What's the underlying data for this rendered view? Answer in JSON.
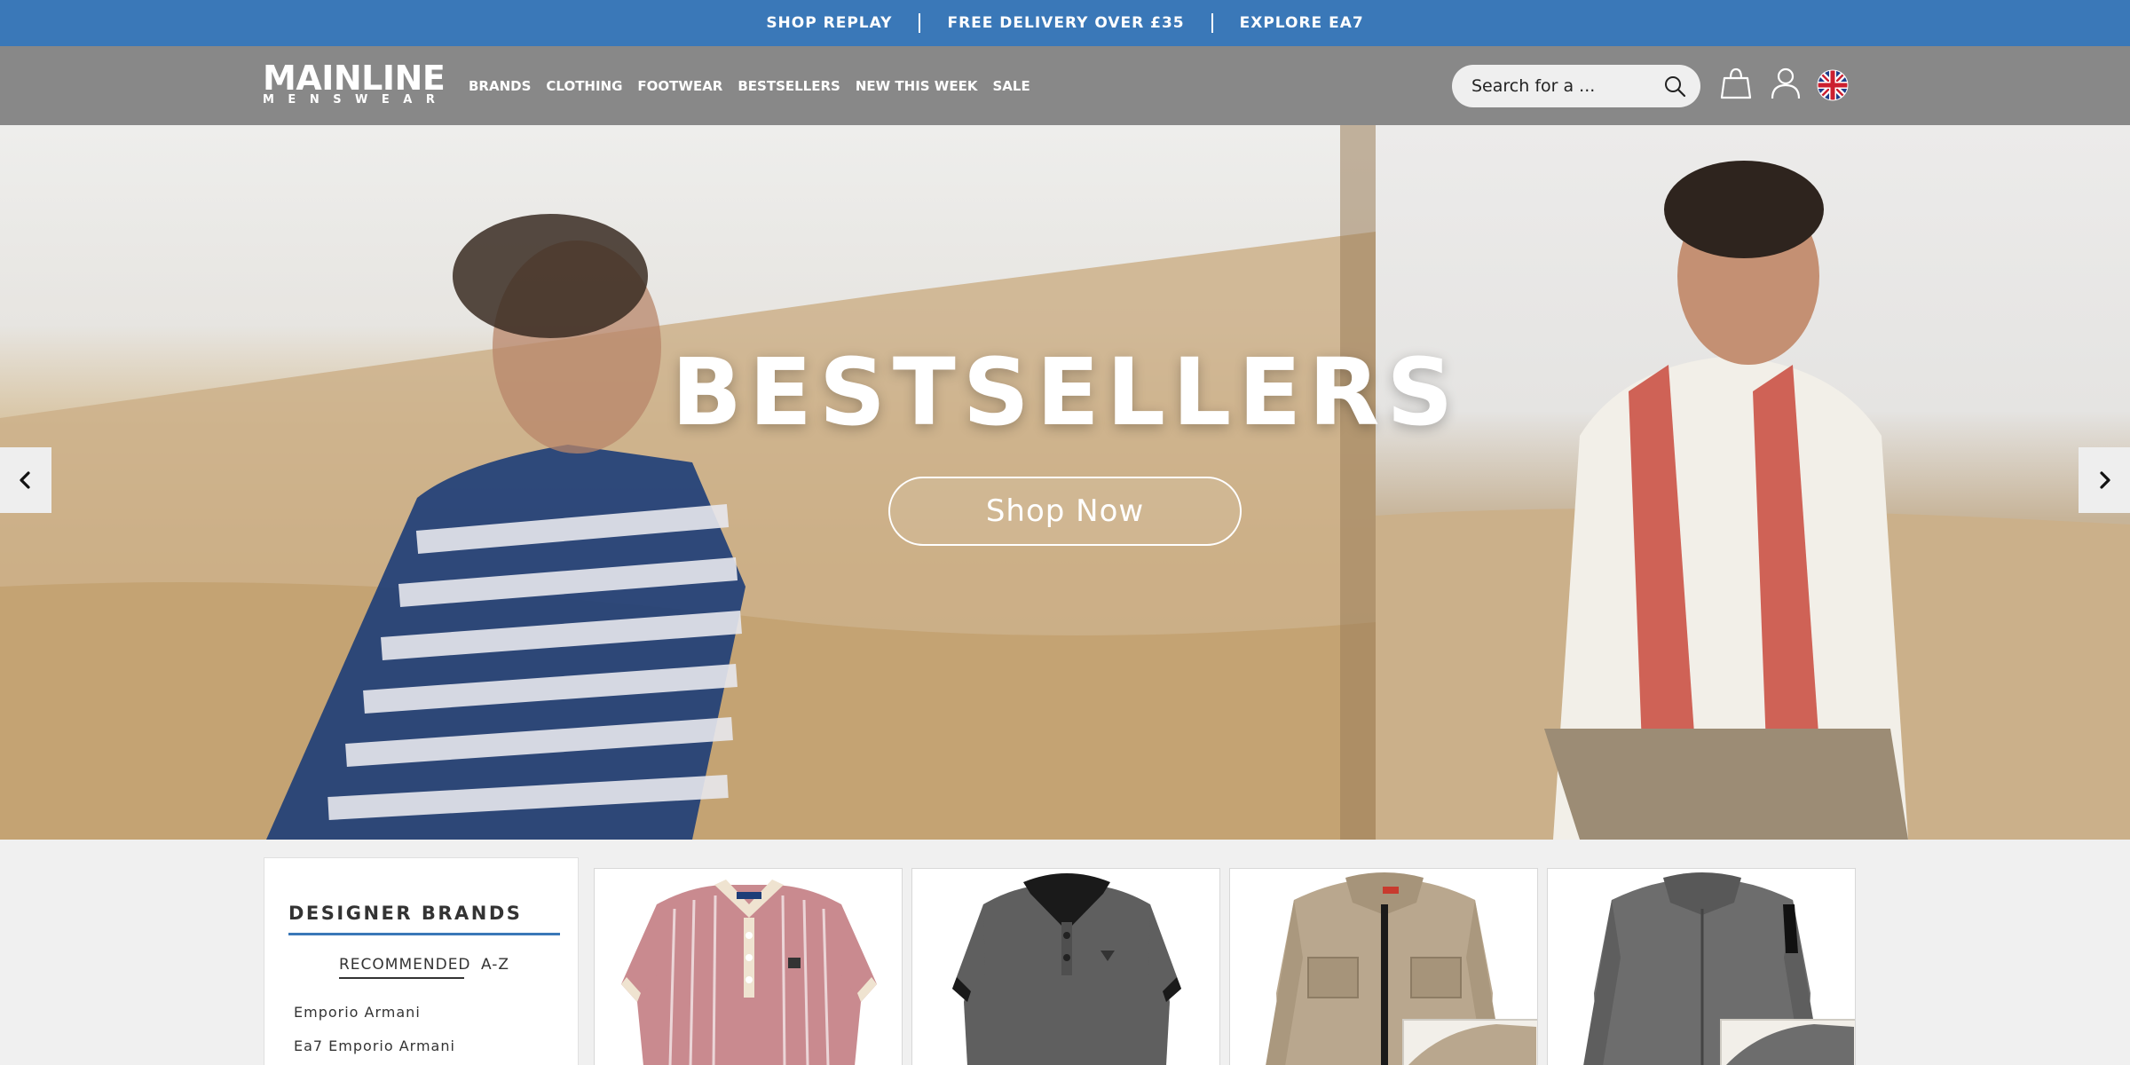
{
  "promo_bar": {
    "items": [
      "SHOP REPLAY",
      "FREE DELIVERY OVER £35",
      "EXPLORE EA7"
    ],
    "color": "#3a78b8"
  },
  "header": {
    "logo_main": "MAINLINE",
    "logo_sub": "MENSWEAR",
    "nav": [
      "BRANDS",
      "CLOTHING",
      "FOOTWEAR",
      "BESTSELLERS",
      "NEW THIS WEEK",
      "SALE"
    ],
    "search_placeholder": "Search for a ...",
    "icons": [
      "search-icon",
      "bag-icon",
      "account-icon",
      "uk-flag-icon"
    ],
    "background": "#888888"
  },
  "hero": {
    "title": "BESTSELLERS",
    "cta": "Shop Now",
    "prev_icon": "chevron-left-icon",
    "next_icon": "chevron-right-icon"
  },
  "brands_panel": {
    "title": "DESIGNER BRANDS",
    "tabs": [
      "RECOMMENDED",
      "A-Z"
    ],
    "active_tab": "RECOMMENDED",
    "brands": [
      "Emporio Armani",
      "Ea7 Emporio Armani"
    ]
  },
  "products": [
    {
      "name": "pink-striped-polo",
      "color": "#c98a8f"
    },
    {
      "name": "grey-polo",
      "color": "#5a5a5a"
    },
    {
      "name": "beige-overshirt",
      "color": "#b9a78e"
    },
    {
      "name": "grey-overshirt",
      "color": "#6a6a6a"
    }
  ]
}
